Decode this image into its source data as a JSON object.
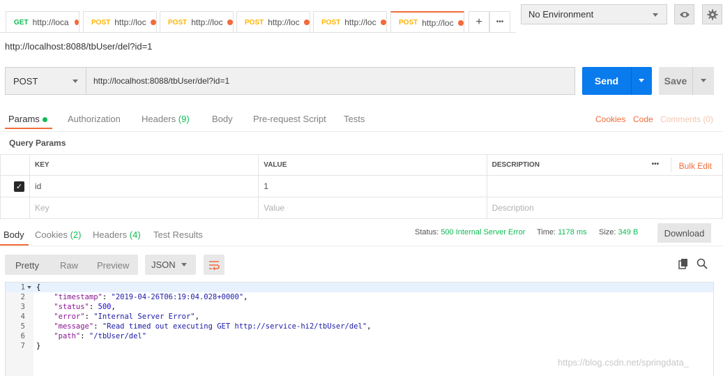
{
  "tabs": [
    {
      "method": "GET",
      "url": "http://loca"
    },
    {
      "method": "POST",
      "url": "http://loc"
    },
    {
      "method": "POST",
      "url": "http://loc"
    },
    {
      "method": "POST",
      "url": "http://loc"
    },
    {
      "method": "POST",
      "url": "http://loc"
    },
    {
      "method": "POST",
      "url": "http://loc"
    }
  ],
  "tab_controls": {
    "add": "+",
    "more": "•••"
  },
  "environment": {
    "selected": "No Environment"
  },
  "request": {
    "title": "http://localhost:8088/tbUser/del?id=1",
    "method": "POST",
    "url": "http://localhost:8088/tbUser/del?id=1",
    "send_label": "Send",
    "save_label": "Save"
  },
  "request_tabs": {
    "params": "Params",
    "authorization": "Authorization",
    "headers": "Headers",
    "headers_count": "(9)",
    "body": "Body",
    "pre_request": "Pre-request Script",
    "tests": "Tests",
    "cookies": "Cookies",
    "code": "Code",
    "comments": "Comments (0)"
  },
  "query_params": {
    "label": "Query Params",
    "columns": {
      "key": "KEY",
      "value": "VALUE",
      "description": "DESCRIPTION"
    },
    "bulk_edit": "Bulk Edit",
    "more": "•••",
    "rows": [
      {
        "key": "id",
        "value": "1",
        "description": ""
      }
    ],
    "placeholders": {
      "key": "Key",
      "value": "Value",
      "description": "Description"
    }
  },
  "response_tabs": {
    "body": "Body",
    "cookies": "Cookies",
    "cookies_count": "(2)",
    "headers": "Headers",
    "headers_count": "(4)",
    "test_results": "Test Results"
  },
  "response_status": {
    "status_label": "Status:",
    "status_value": "500 Internal Server Error",
    "time_label": "Time:",
    "time_value": "1178 ms",
    "size_label": "Size:",
    "size_value": "349 B",
    "download": "Download"
  },
  "body_view": {
    "pretty": "Pretty",
    "raw": "Raw",
    "preview": "Preview",
    "format": "JSON"
  },
  "code_lines": {
    "numbers": [
      "1",
      "2",
      "3",
      "4",
      "5",
      "6",
      "7"
    ],
    "open": "{",
    "close": "}",
    "timestamp_key": "\"timestamp\"",
    "timestamp_val": "\"2019-04-26T06:19:04.028+0000\"",
    "status_key": "\"status\"",
    "status_val": "500",
    "error_key": "\"error\"",
    "error_val": "\"Internal Server Error\"",
    "message_key": "\"message\"",
    "message_val": "\"Read timed out executing GET http://service-hi2/tbUser/del\"",
    "path_key": "\"path\"",
    "path_val": "\"/tbUser/del\""
  },
  "watermark": "https://blog.csdn.net/springdata_",
  "colors": {
    "accent": "#f26b3a",
    "send": "#097bed",
    "success": "#0cbb52",
    "get": "#0cbb52",
    "post": "#ffb400"
  }
}
